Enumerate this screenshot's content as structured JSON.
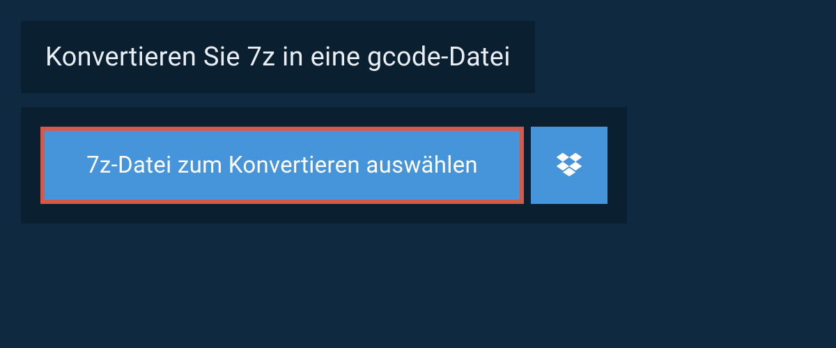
{
  "header": {
    "title": "Konvertieren Sie 7z in eine gcode-Datei"
  },
  "upload": {
    "choose_file_label": "7z-Datei zum Konvertieren auswählen",
    "dropbox_icon": "dropbox-icon"
  },
  "colors": {
    "page_bg": "#0f2940",
    "panel_bg": "#0a1f2f",
    "button_bg": "#4694d9",
    "highlight_border": "#d35a4a",
    "text_light": "#e8eef4",
    "text_white": "#ffffff"
  }
}
